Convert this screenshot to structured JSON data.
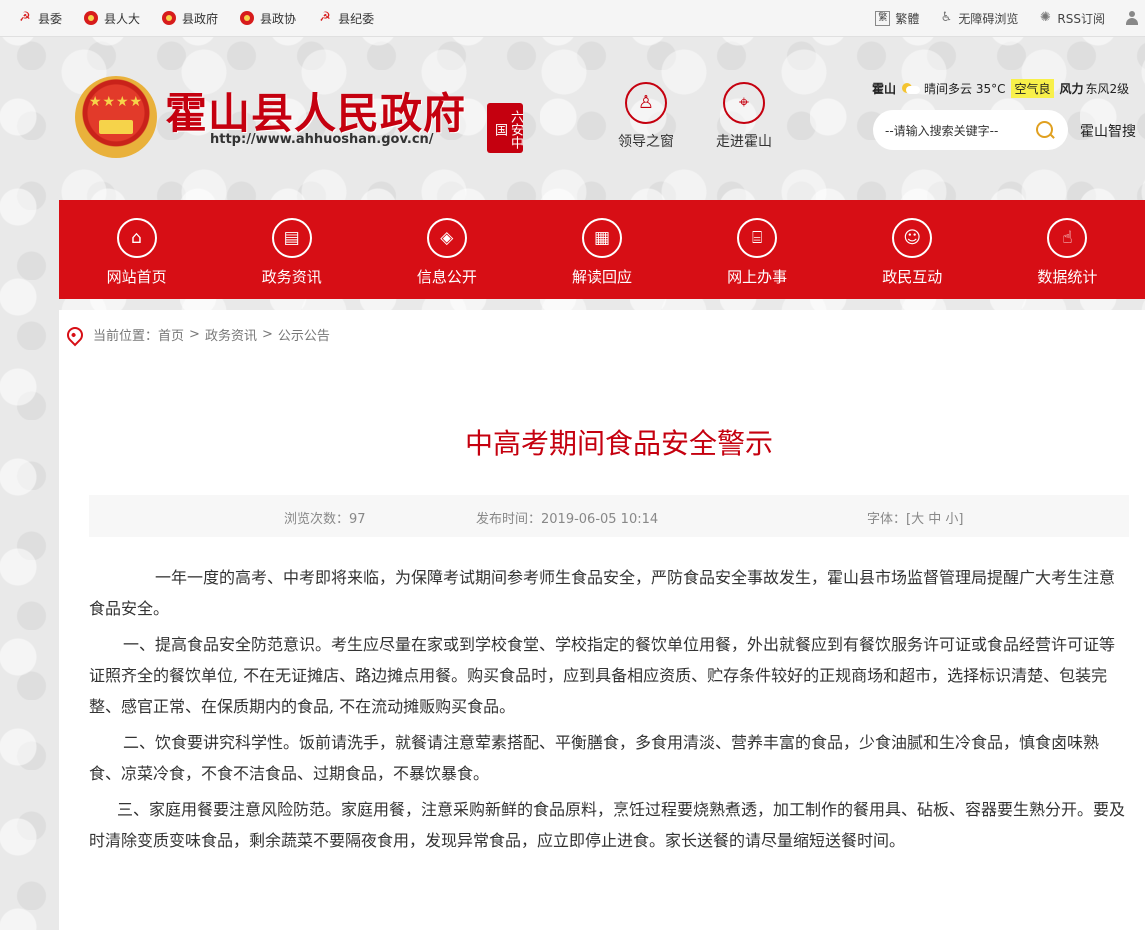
{
  "topbar": {
    "links": [
      "县委",
      "县人大",
      "县政府",
      "县政协",
      "县纪委"
    ],
    "right": {
      "traditional": "繁體",
      "accessibility": "无障碍浏览",
      "rss": "RSS订阅"
    }
  },
  "header": {
    "site_title": "霍山县人民政府",
    "site_url": "http://www.ahhuoshan.gov.cn/",
    "seal_text": "六安中国",
    "nav": [
      {
        "label": "领导之窗",
        "icon": "leader-icon"
      },
      {
        "label": "走进霍山",
        "icon": "location-icon"
      }
    ],
    "weather": {
      "city": "霍山",
      "condition": "晴间多云 35°C",
      "air_quality": "空气良",
      "wind_label": "风力",
      "wind_value": "东风2级"
    },
    "search": {
      "placeholder": "--请输入搜索关键字--"
    },
    "smart_search": "霍山智搜"
  },
  "main_nav": [
    {
      "label": "网站首页",
      "icon": "home-icon"
    },
    {
      "label": "政务资讯",
      "icon": "news-icon"
    },
    {
      "label": "信息公开",
      "icon": "layers-icon"
    },
    {
      "label": "解读回应",
      "icon": "document-icon"
    },
    {
      "label": "网上办事",
      "icon": "building-icon"
    },
    {
      "label": "政民互动",
      "icon": "chat-icon"
    },
    {
      "label": "数据统计",
      "icon": "hand-icon"
    }
  ],
  "breadcrumb": {
    "prefix": "当前位置：",
    "items": [
      "首页",
      "政务资讯",
      "公示公告"
    ],
    "separator": ">"
  },
  "article": {
    "title": "中高考期间食品安全警示",
    "views": "浏览次数：97",
    "published": "发布时间：2019-06-05 10:14",
    "font_label": "字体：[",
    "font_large": "大",
    "font_medium": "中",
    "font_small": "小",
    "font_close": "]",
    "paragraphs": [
      "一年一度的高考、中考即将来临，为保障考试期间参考师生食品安全，严防食品安全事故发生，霍山县市场监督管理局提醒广大考生注意食品安全。",
      "一、提高食品安全防范意识。考生应尽量在家或到学校食堂、学校指定的餐饮单位用餐，外出就餐应到有餐饮服务许可证或食品经营许可证等证照齐全的餐饮单位, 不在无证摊店、路边摊点用餐。购买食品时，应到具备相应资质、贮存条件较好的正规商场和超市，选择标识清楚、包装完整、感官正常、在保质期内的食品, 不在流动摊贩购买食品。",
      "二、饮食要讲究科学性。饭前请洗手，就餐请注意荤素搭配、平衡膳食，多食用清淡、营养丰富的食品，少食油腻和生冷食品，慎食卤味熟食、凉菜冷食，不食不洁食品、过期食品，不暴饮暴食。",
      "三、家庭用餐要注意风险防范。家庭用餐，注意采购新鲜的食品原料，烹饪过程要烧熟煮透，加工制作的餐用具、砧板、容器要生熟分开。要及时清除变质变味食品，剩余蔬菜不要隔夜食用，发现异常食品，应立即停止进食。家长送餐的请尽量缩短送餐时间。"
    ]
  },
  "colors": {
    "brand_red": "#d70e15",
    "title_red": "#c5000f"
  }
}
